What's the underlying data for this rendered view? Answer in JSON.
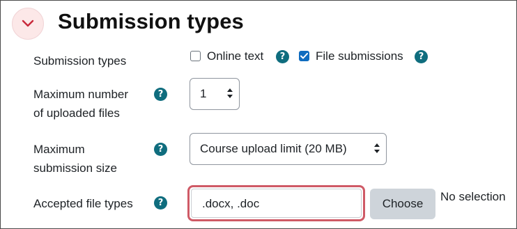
{
  "section": {
    "title": "Submission types",
    "collapse_icon": "chevron-down-icon"
  },
  "rows": {
    "submission_types": {
      "label": "Submission types",
      "options": [
        {
          "label": "Online text",
          "checked": false
        },
        {
          "label": "File submissions",
          "checked": true
        }
      ]
    },
    "max_files": {
      "label_line1": "Maximum number",
      "label_line2": "of uploaded files",
      "value": "1"
    },
    "max_size": {
      "label_line1": "Maximum",
      "label_line2": "submission size",
      "value": "Course upload limit (20 MB)"
    },
    "file_types": {
      "label": "Accepted file types",
      "value": ".docx, .doc",
      "choose_label": "Choose",
      "selection_status": "No selection"
    }
  },
  "colors": {
    "accent": "#0f6cbf",
    "help_icon": "#0f6d7e",
    "collapse_bg": "#fce8e8",
    "collapse_chevron": "#c8283a",
    "highlight_border": "#cf5a66"
  },
  "icons": {
    "help": "question-circle-icon",
    "select_arrows": "sort-arrows-icon",
    "check": "check-icon"
  }
}
